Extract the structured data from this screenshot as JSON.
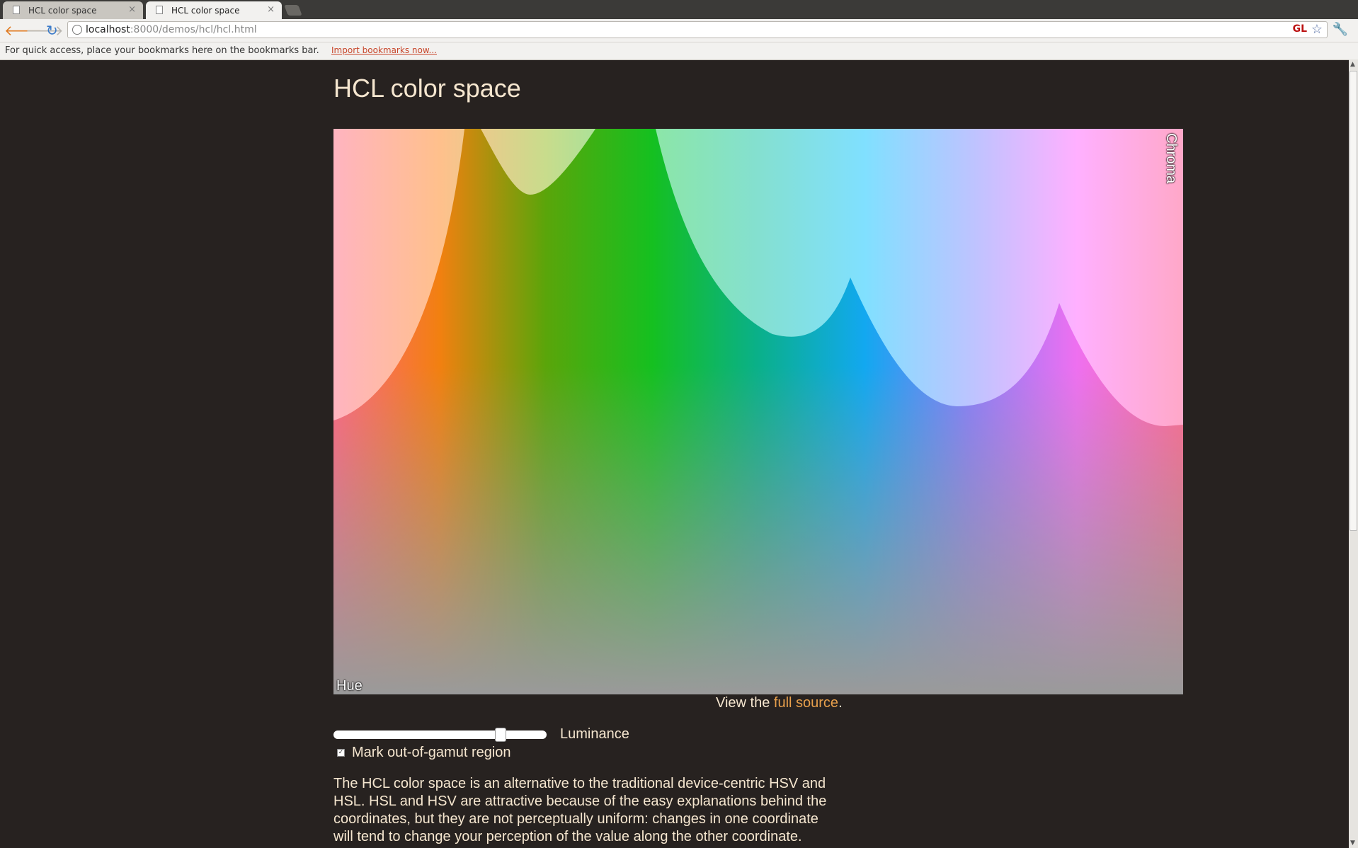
{
  "browser": {
    "tabs": [
      {
        "label": "HCL color space",
        "active": false
      },
      {
        "label": "HCL color space",
        "active": true
      }
    ],
    "url_host": "localhost",
    "url_rest": ":8000/demos/hcl/hcl.html",
    "gl_badge": "GL",
    "bookmarks_message": "For quick access, place your bookmarks here on the bookmarks bar.",
    "import_link": "Import bookmarks now..."
  },
  "page": {
    "title": "HCL color space",
    "source_prefix": "View the ",
    "source_link": "full source",
    "source_suffix": ".",
    "luminance_label": "Luminance",
    "luminance_value": 0.8,
    "gamut_label": "Mark out-of-gamut region",
    "gamut_checked": true,
    "description": "The HCL color space is an alternative to the traditional device-centric HSV and HSL. HSL and HSV are attractive because of the easy explanations behind the coordinates, but they are not perceptually uniform: changes in one coordinate will tend to change your perception of the value along the other coordinate."
  },
  "chart_data": {
    "type": "heatmap",
    "xlabel": "Hue",
    "ylabel": "Chroma",
    "hue_stops": [
      "#ff6680",
      "#f28010",
      "#5aa50a",
      "#15c020",
      "#0ab08a",
      "#12a8f0",
      "#8a7ef8",
      "#ee70f0",
      "#ff6a90"
    ],
    "pale_stops": [
      "#ffb4c0",
      "#ffc08c",
      "#c8dc8c",
      "#8ce6a6",
      "#84e0d0",
      "#80e0ff",
      "#bcc4ff",
      "#ffb0ff",
      "#ffa8c8"
    ],
    "base_color": "#9a9a9a"
  },
  "icons": {
    "back": "back-arrow-icon",
    "forward": "forward-arrow-icon",
    "reload": "reload-icon",
    "star": "star-icon",
    "wrench": "wrench-icon"
  }
}
